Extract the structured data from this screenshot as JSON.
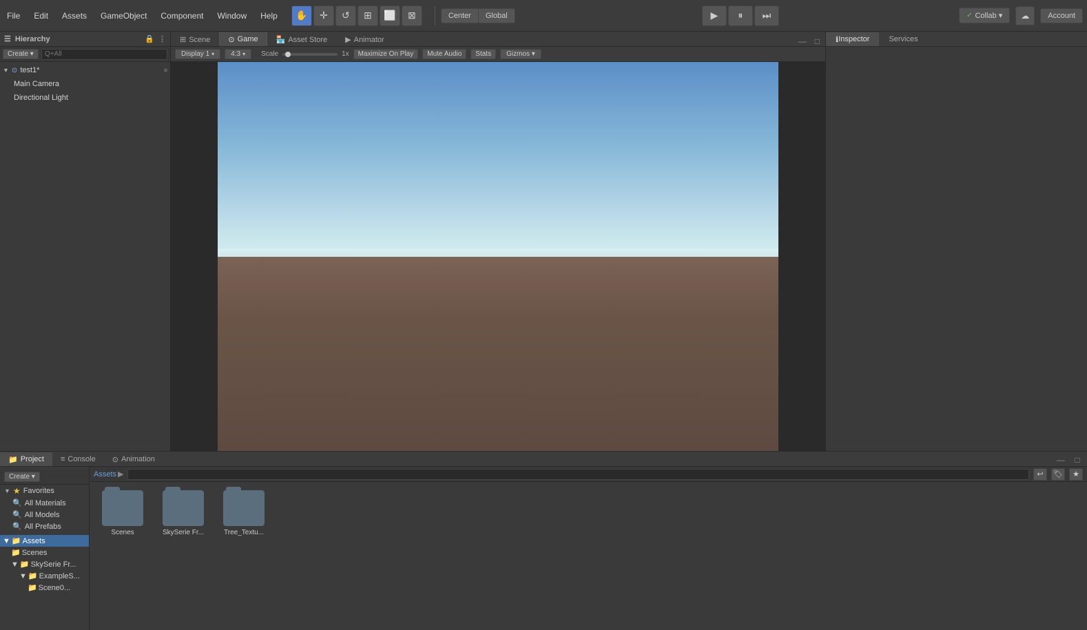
{
  "menuBar": {
    "items": [
      "File",
      "Edit",
      "Assets",
      "GameObject",
      "Component",
      "Window",
      "Help"
    ]
  },
  "toolbar": {
    "tools": [
      {
        "name": "hand-tool",
        "icon": "✋",
        "active": true
      },
      {
        "name": "move-tool",
        "icon": "✛",
        "active": false
      },
      {
        "name": "rotate-tool",
        "icon": "↺",
        "active": false
      },
      {
        "name": "scale-tool",
        "icon": "⊞",
        "active": false
      },
      {
        "name": "rect-tool",
        "icon": "⬜",
        "active": false
      },
      {
        "name": "transform-tool",
        "icon": "⊠",
        "active": false
      }
    ],
    "pivot": {
      "center": "Center",
      "global": "Global"
    },
    "play": {
      "play": "▶",
      "pause": "⏸",
      "step": "⏭"
    },
    "collab": "Collab ▾",
    "cloud": "☁",
    "account": "Account"
  },
  "hierarchy": {
    "panelTitle": "Hierarchy",
    "createLabel": "Create ▾",
    "searchPlaceholder": "Q+All",
    "scene": "test1*",
    "items": [
      {
        "name": "Main Camera",
        "icon": "📷"
      },
      {
        "name": "Directional Light",
        "icon": "💡"
      }
    ]
  },
  "tabs": {
    "scene": "Scene",
    "game": "Game",
    "assetStore": "Asset Store",
    "animator": "Animator"
  },
  "gameView": {
    "display": "Display 1",
    "aspect": "4:3",
    "scaleLabel": "Scale",
    "scaleValue": "1x",
    "maximizeOnPlay": "Maximize On Play",
    "muteAudio": "Mute Audio",
    "stats": "Stats",
    "gizmos": "Gizmos ▾"
  },
  "inspector": {
    "tab1": "Inspector",
    "tab2": "Services"
  },
  "bottomPanel": {
    "tabs": [
      "Project",
      "Console",
      "Animation"
    ],
    "tabIcons": [
      "📁",
      "≡",
      "⊙"
    ],
    "createLabel": "Create ▾",
    "searchPlaceholder": ""
  },
  "favorites": {
    "header": "Favorites",
    "items": [
      "All Materials",
      "All Models",
      "All Prefabs"
    ]
  },
  "assets": {
    "header": "Assets",
    "breadcrumbLabel": "Assets",
    "items": [
      {
        "name": "Scenes",
        "type": "folder"
      },
      {
        "name": "SkySerie Fr...",
        "type": "folder"
      },
      {
        "name": "Tree_Textu...",
        "type": "folder"
      }
    ],
    "treeItems": [
      {
        "name": "Scenes",
        "level": 1
      },
      {
        "name": "SkySerie Fr...",
        "level": 1
      },
      {
        "name": "ExampleS...",
        "level": 2
      },
      {
        "name": "Scene0...",
        "level": 3
      }
    ]
  }
}
